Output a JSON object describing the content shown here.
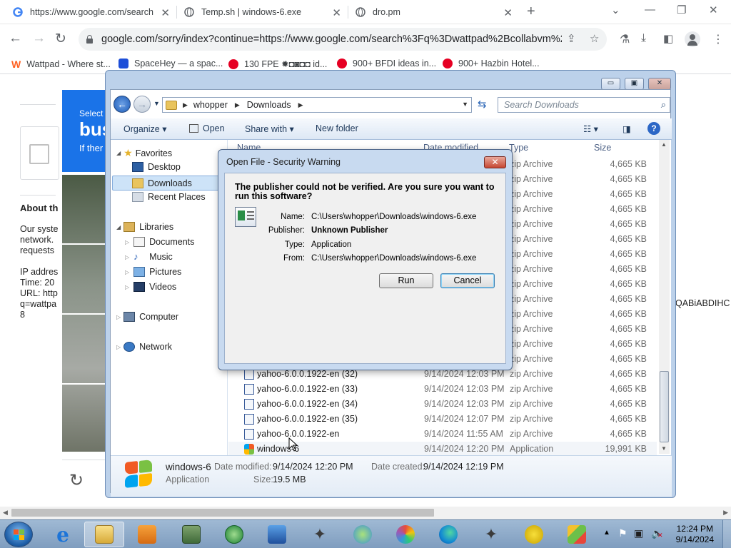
{
  "browser": {
    "tabs": [
      {
        "label": "https://www.google.com/search",
        "active": true
      },
      {
        "label": "Temp.sh | windows-6.exe",
        "active": false
      },
      {
        "label": "dro.pm",
        "active": false
      }
    ],
    "new_tab": "+",
    "address": "google.com/sorry/index?continue=https://www.google.com/search%3Fq%3Dwattpad%2Bcollabvm%2...",
    "bookmarks": [
      {
        "label": "Wattpad - Where st...",
        "color": "#ff6122"
      },
      {
        "label": "SpaceHey — a spac...",
        "color": "#1d4ed8"
      },
      {
        "label": "130 FPE ✹◘◙◘◘ id...",
        "color": "#e60023"
      },
      {
        "label": "900+ BFDI ideas in...",
        "color": "#e60023"
      },
      {
        "label": "900+ Hazbin Hotel...",
        "color": "#e60023"
      }
    ]
  },
  "background_page": {
    "select_text": "Select",
    "bus_text": "bus",
    "if_text": "If ther",
    "about": "About th",
    "lines": [
      "Our syste",
      "network.",
      "requests",
      "",
      "IP addres",
      "Time: 20",
      "URL: http",
      "q=wattpa",
      "8"
    ],
    "right_fragment": "QABiABDIHC"
  },
  "explorer": {
    "path": [
      "whopper",
      "Downloads"
    ],
    "search_placeholder": "Search Downloads",
    "toolbar": {
      "organize": "Organize",
      "open": "Open",
      "share_with": "Share with",
      "new_folder": "New folder"
    },
    "nav": {
      "favorites": "Favorites",
      "desktop": "Desktop",
      "downloads": "Downloads",
      "recent": "Recent Places",
      "libraries": "Libraries",
      "documents": "Documents",
      "music": "Music",
      "pictures": "Pictures",
      "videos": "Videos",
      "computer": "Computer",
      "network": "Network"
    },
    "columns": {
      "name": "Name",
      "date": "Date modified",
      "type": "Type",
      "size": "Size"
    },
    "hidden_rows": [
      {
        "type": "zip Archive",
        "size": "4,665 KB"
      },
      {
        "type": "zip Archive",
        "size": "4,665 KB"
      },
      {
        "type": "zip Archive",
        "size": "4,665 KB"
      },
      {
        "type": "zip Archive",
        "size": "4,665 KB"
      },
      {
        "type": "zip Archive",
        "size": "4,665 KB"
      },
      {
        "type": "zip Archive",
        "size": "4,665 KB"
      },
      {
        "type": "zip Archive",
        "size": "4,665 KB"
      },
      {
        "type": "zip Archive",
        "size": "4,665 KB"
      },
      {
        "type": "zip Archive",
        "size": "4,665 KB"
      },
      {
        "type": "zip Archive",
        "size": "4,665 KB"
      },
      {
        "type": "zip Archive",
        "size": "4,665 KB"
      },
      {
        "type": "zip Archive",
        "size": "4,665 KB"
      },
      {
        "type": "zip Archive",
        "size": "4,665 KB"
      },
      {
        "type": "zip Archive",
        "size": "4,665 KB"
      }
    ],
    "files": [
      {
        "name": "yahoo-6.0.0.1922-en (32)",
        "date": "9/14/2024 12:03 PM",
        "type": "zip Archive",
        "size": "4,665 KB"
      },
      {
        "name": "yahoo-6.0.0.1922-en (33)",
        "date": "9/14/2024 12:03 PM",
        "type": "zip Archive",
        "size": "4,665 KB"
      },
      {
        "name": "yahoo-6.0.0.1922-en (34)",
        "date": "9/14/2024 12:03 PM",
        "type": "zip Archive",
        "size": "4,665 KB"
      },
      {
        "name": "yahoo-6.0.0.1922-en (35)",
        "date": "9/14/2024 12:07 PM",
        "type": "zip Archive",
        "size": "4,665 KB"
      },
      {
        "name": "yahoo-6.0.0.1922-en",
        "date": "9/14/2024 11:55 AM",
        "type": "zip Archive",
        "size": "4,665 KB"
      },
      {
        "name": "windows-6",
        "date": "9/14/2024 12:20 PM",
        "type": "Application",
        "size": "19,991 KB"
      }
    ],
    "details": {
      "name": "windows-6",
      "kind": "Application",
      "modified_label": "Date modified:",
      "modified": "9/14/2024 12:20 PM",
      "created_label": "Date created:",
      "created": "9/14/2024 12:19 PM",
      "size_label": "Size:",
      "size": "19.5 MB"
    }
  },
  "dialog": {
    "title": "Open File - Security Warning",
    "warning": "The publisher could not be verified.  Are you sure you want to run this software?",
    "fields": [
      {
        "label": "Name:",
        "value": "C:\\Users\\whopper\\Downloads\\windows-6.exe",
        "bold": false
      },
      {
        "label": "Publisher:",
        "value": "Unknown Publisher",
        "bold": true
      },
      {
        "label": "Type:",
        "value": "Application",
        "bold": false
      },
      {
        "label": "From:",
        "value": "C:\\Users\\whopper\\Downloads\\windows-6.exe",
        "bold": false
      }
    ],
    "run": "Run",
    "cancel": "Cancel"
  },
  "taskbar": {
    "time": "12:24 PM",
    "date": "9/14/2024"
  }
}
